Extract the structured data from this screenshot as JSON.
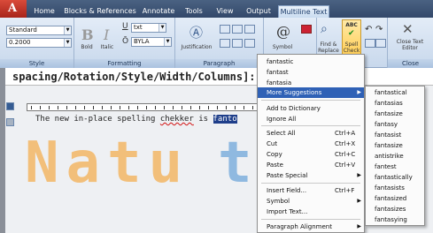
{
  "tabs": [
    {
      "label": "Home"
    },
    {
      "label": "Blocks & References"
    },
    {
      "label": "Annotate"
    },
    {
      "label": "Tools"
    },
    {
      "label": "View"
    },
    {
      "label": "Output"
    },
    {
      "label": "Multiline Text"
    }
  ],
  "ribbon": {
    "style": {
      "label": "Style",
      "style_value": "Standard",
      "height_value": "0.2000"
    },
    "formatting": {
      "label": "Formatting",
      "bold_label": "Bold",
      "italic_label": "Italic",
      "font_value": "txt",
      "color_value": "BYLA"
    },
    "paragraph": {
      "label": "Paragraph",
      "justification_label": "Justification"
    },
    "insert": {
      "symbol_label": "Symbol"
    },
    "tools": {
      "find_replace_label": "Find & Replace",
      "spell_check_label": "Spell Check",
      "spell_icon_text": "ABC"
    },
    "close": {
      "label": "Close",
      "close_editor_label": "Close Text Editor"
    }
  },
  "command_line": {
    "text": "spacing/Rotation/Style/Width/Columns]:"
  },
  "editor": {
    "text_before": "The new in-place spelling ",
    "misspelled": "chekker",
    "text_between": " is ",
    "highlighted": "fanto"
  },
  "watermark": {
    "part1": "Natu",
    "part2": "toc"
  },
  "context_menu": {
    "items": [
      {
        "label": "fantastic"
      },
      {
        "label": "fantast"
      },
      {
        "label": "fantasia"
      },
      {
        "label": "More Suggestions",
        "submenu": true
      },
      {
        "label": "Add to Dictionary"
      },
      {
        "label": "Ignore All"
      },
      {
        "label": "Select All",
        "shortcut": "Ctrl+A"
      },
      {
        "label": "Cut",
        "shortcut": "Ctrl+X"
      },
      {
        "label": "Copy",
        "shortcut": "Ctrl+C"
      },
      {
        "label": "Paste",
        "shortcut": "Ctrl+V"
      },
      {
        "label": "Paste Special",
        "submenu": true
      },
      {
        "label": "Insert Field...",
        "shortcut": "Ctrl+F"
      },
      {
        "label": "Symbol",
        "submenu": true
      },
      {
        "label": "Import Text..."
      },
      {
        "label": "Paragraph Alignment",
        "submenu": true
      }
    ]
  },
  "submenu": {
    "items": [
      {
        "label": "fantastical"
      },
      {
        "label": "fantasias"
      },
      {
        "label": "fantasize"
      },
      {
        "label": "fantasy"
      },
      {
        "label": "fantasist"
      },
      {
        "label": "fantasize"
      },
      {
        "label": "antistrike"
      },
      {
        "label": "fantest"
      },
      {
        "label": "fantastically"
      },
      {
        "label": "fantasists"
      },
      {
        "label": "fantasized"
      },
      {
        "label": "fantasizes"
      },
      {
        "label": "fantasying"
      }
    ]
  },
  "colors": {
    "tab_strip": "#33486a",
    "ribbon": "#dce7f5",
    "menu_highlight": "#2f61b6",
    "text_highlight": "#1e3e8a",
    "watermark_orange": "#f3b766",
    "watermark_blue": "#7fb0dd"
  }
}
